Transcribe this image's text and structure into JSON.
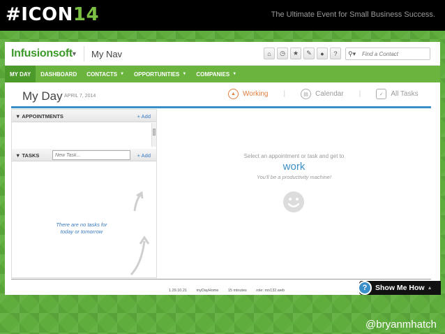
{
  "slide": {
    "brand_prefix": "#ICON",
    "brand_number": "14",
    "tagline": "The Ultimate Event for Small Business Success.",
    "handle": "@bryanmhatch"
  },
  "header": {
    "logo": "Infusionsoft",
    "nav_title": "My Nav",
    "icons": [
      "home-icon",
      "clock-icon",
      "star-icon",
      "pin-icon",
      "person-icon",
      "help-icon"
    ],
    "search_placeholder": "Find a Contact"
  },
  "nav": {
    "items": [
      {
        "label": "MY DAY",
        "active": true,
        "dropdown": false
      },
      {
        "label": "DASHBOARD",
        "active": false,
        "dropdown": false
      },
      {
        "label": "CONTACTS",
        "active": false,
        "dropdown": true
      },
      {
        "label": "OPPORTUNITIES",
        "active": false,
        "dropdown": true
      },
      {
        "label": "COMPANIES",
        "active": false,
        "dropdown": true
      }
    ]
  },
  "day": {
    "title": "My Day",
    "date": "APRIL 7, 2014",
    "views": [
      {
        "label": "Working",
        "active": true
      },
      {
        "label": "Calendar",
        "active": false
      },
      {
        "label": "All Tasks",
        "active": false
      }
    ]
  },
  "appointments": {
    "label": "APPOINTMENTS",
    "add": "+ Add"
  },
  "tasks": {
    "label": "TASKS",
    "placeholder": "New Task...",
    "add": "+ Add",
    "empty_line1": "There are no tasks for",
    "empty_line2": "today or tomorrow"
  },
  "work_panel": {
    "line1": "Select an appointment or task and get to",
    "line2": "work",
    "line3": "You'll be a productivity machine!"
  },
  "footer": {
    "version": "1.29.10.21",
    "page": "myDayHome",
    "age": "15 minutes",
    "role": "role: mn132.web"
  },
  "show_me": {
    "label": "Show Me How",
    "icon_text": "?"
  },
  "colors": {
    "green_nav": "#6bb53f",
    "green_active": "#4c9a2a",
    "accent_blue": "#3a8fc9",
    "working_orange": "#e07d3c"
  }
}
